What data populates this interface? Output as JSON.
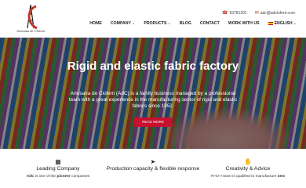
{
  "brand": {
    "logo_text": "Artesana de Clofent"
  },
  "topbar": {
    "phone": "93781201",
    "email": "adc@adclofent.com"
  },
  "nav": {
    "items": [
      "HOME",
      "COMPANY",
      "PRODUCTS",
      "BLOG",
      "CONTACT",
      "WORK WITH US"
    ],
    "language": "ENGLISH"
  },
  "hero": {
    "title": "Rigid and elastic fabric factory",
    "description": "Artesana de Clofent (AdC) is a family business managed by a professional team with a great experience in the manufacturing sector of rigid and elastic fabrics since 1952.",
    "button": "READ MORE"
  },
  "features": [
    {
      "icon": "building-icon",
      "title": "Leading Company",
      "text_prefix": "AdC",
      "text_middle": " is one of the ",
      "text_strong": "pioneer",
      "text_suffix": " companies"
    },
    {
      "icon": "paper-plane-icon",
      "title": "Production capacity & flexible response",
      "text": ""
    },
    {
      "icon": "handshake-icon",
      "title": "Creativity & Advice",
      "text_prefix": "",
      "text_middle": "R+D+I team is qualified to manufacture ",
      "text_strong": "new",
      "text_suffix": ""
    }
  ],
  "colors": {
    "accent": "#c8102e"
  }
}
